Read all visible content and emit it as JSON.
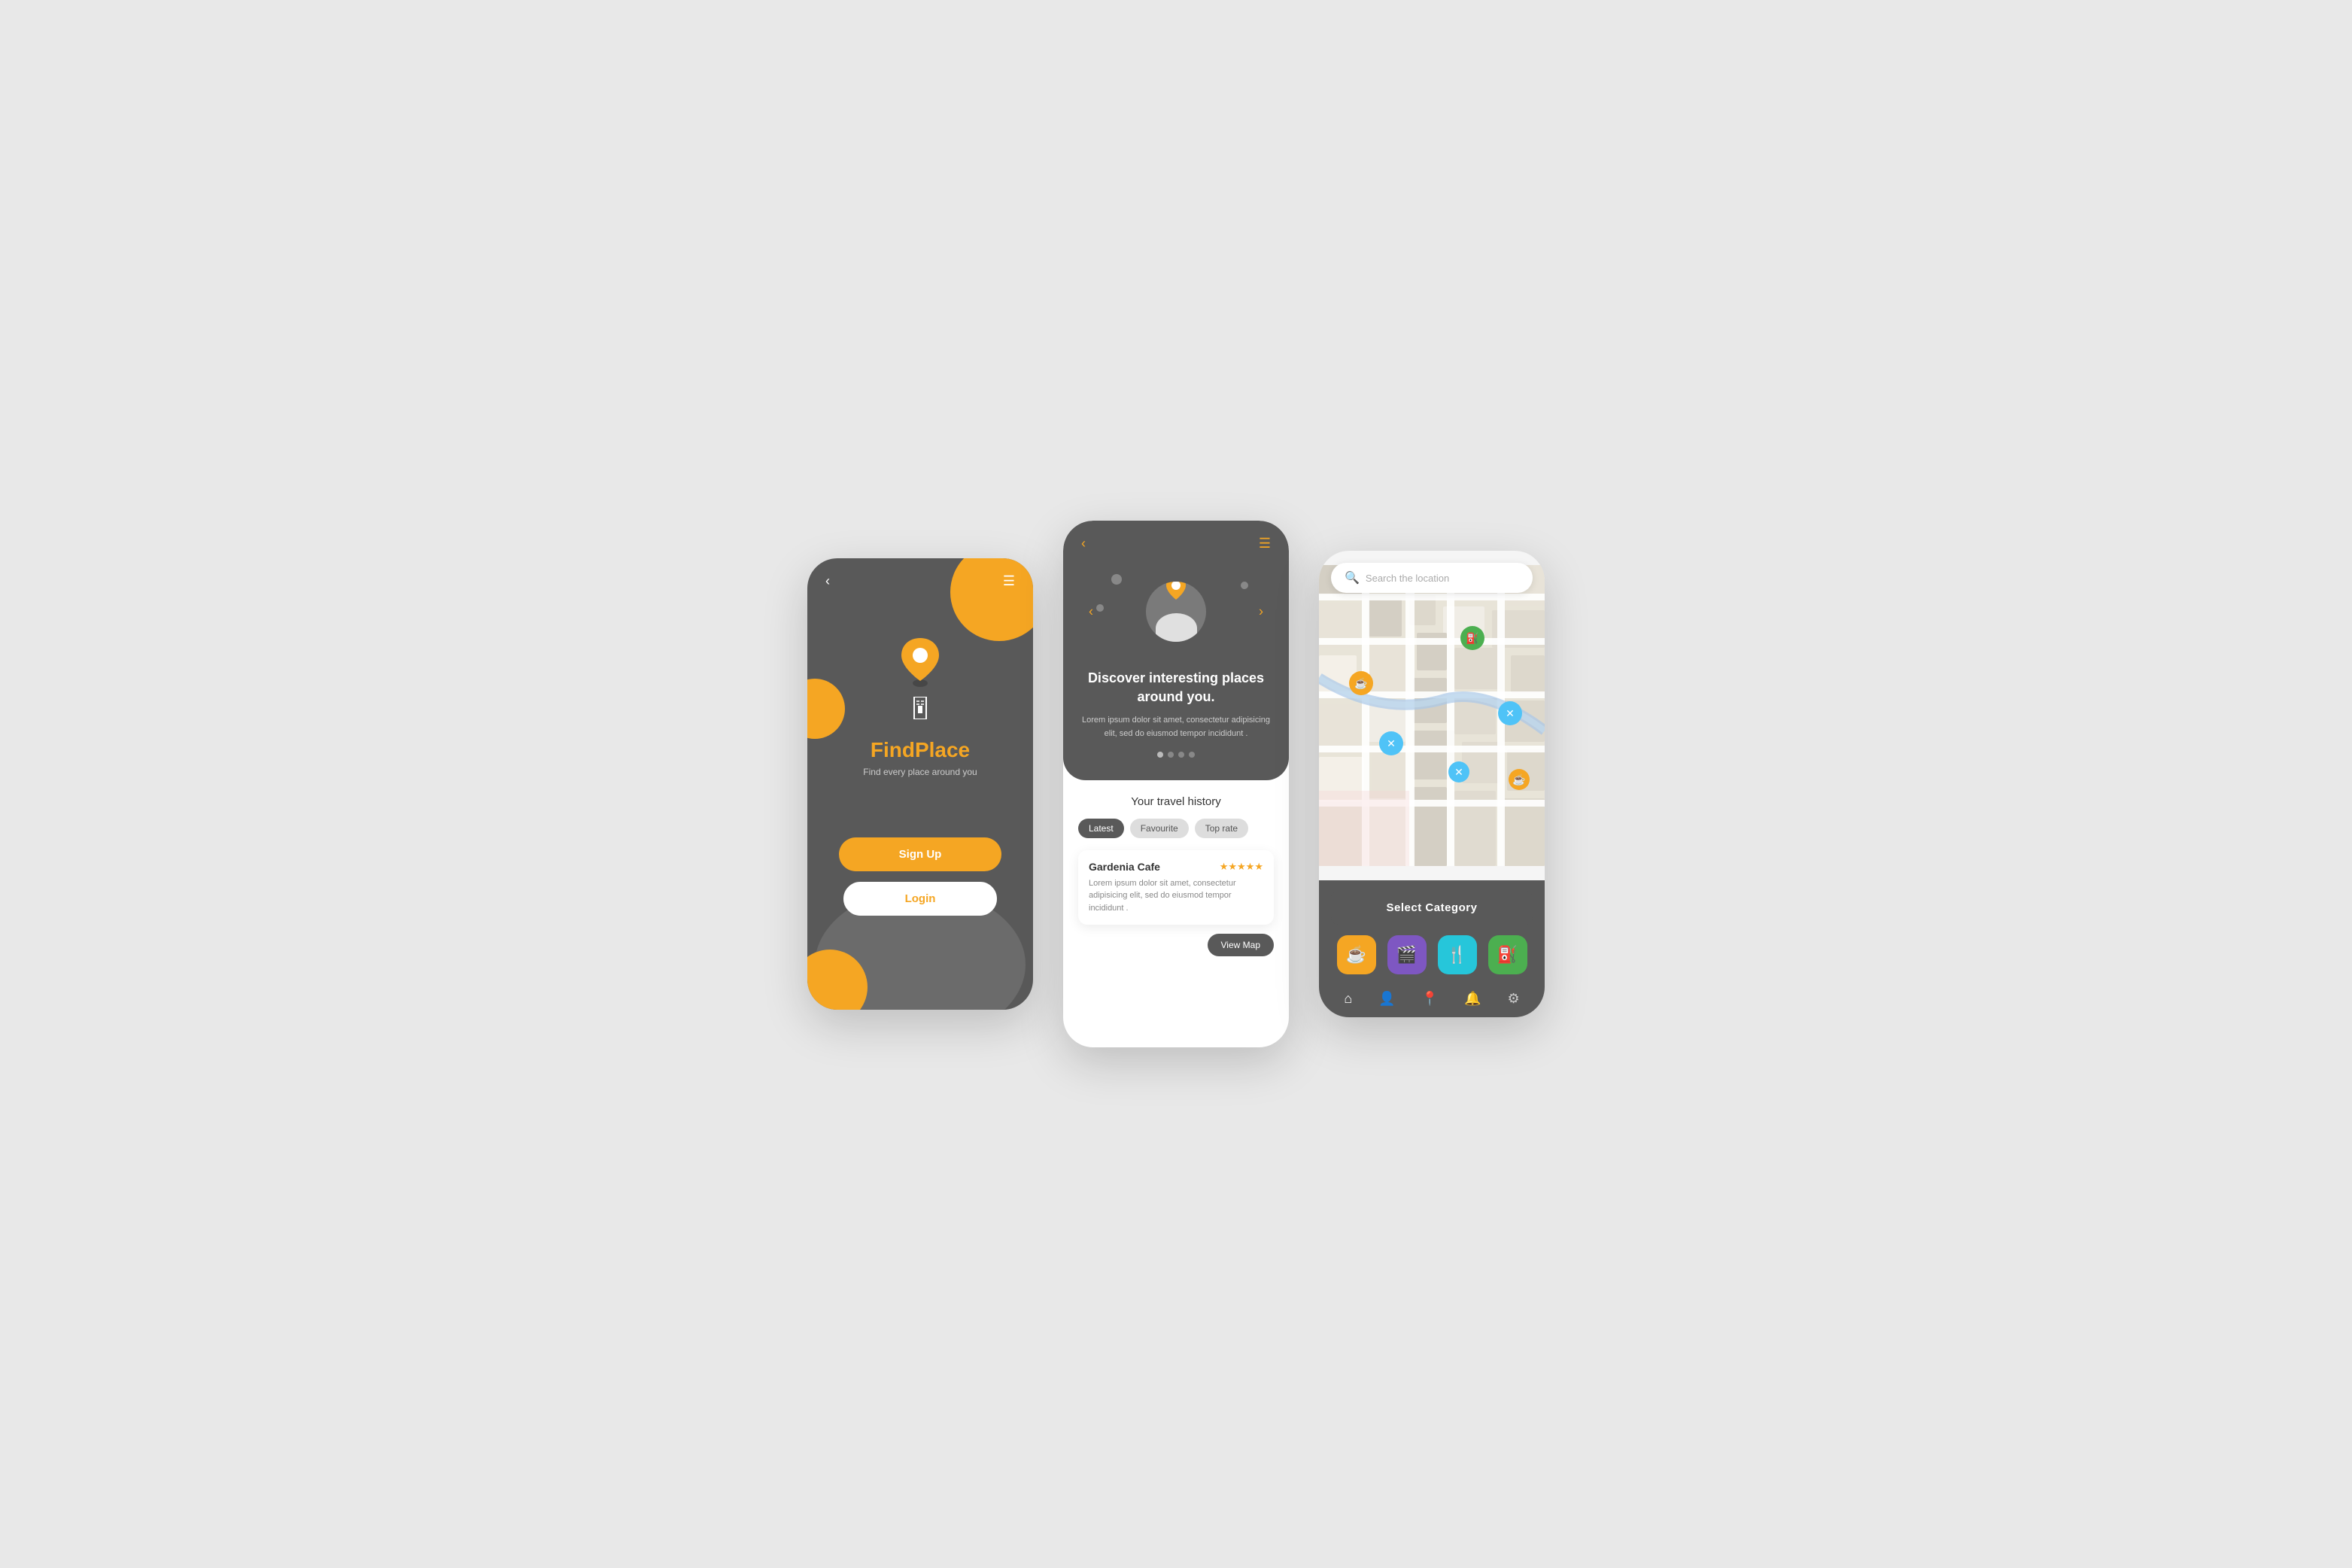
{
  "screen1": {
    "back_label": "‹",
    "menu_label": "☰",
    "app_name_regular": "Find",
    "app_name_bold": "Place",
    "subtitle": "Find every place around you",
    "signup_label": "Sign Up",
    "login_label": "Login"
  },
  "screen2": {
    "back_label": "‹",
    "menu_label": "☰",
    "discover_title": "Discover interesting places around you.",
    "discover_desc": "Lorem ipsum dolor sit amet, consectetur adipisicing elit, sed do eiusmod tempor incididunt .",
    "travel_history_label": "Your travel history",
    "tabs": [
      {
        "label": "Latest",
        "active": true
      },
      {
        "label": "Favourite",
        "active": false
      },
      {
        "label": "Top rate",
        "active": false
      }
    ],
    "place_name": "Gardenia Cafe",
    "stars": "★★★★★",
    "place_desc": "Lorem ipsum dolor sit amet, consectetur adipisicing elit, sed do eiusmod tempor incididunt .",
    "view_map_label": "View Map"
  },
  "screen3": {
    "search_placeholder": "Search the location",
    "select_category_label": "Select Category",
    "categories": [
      {
        "icon": "☕",
        "color": "cat-orange",
        "name": "cafe"
      },
      {
        "icon": "🎬",
        "color": "cat-purple",
        "name": "cinema"
      },
      {
        "icon": "🍴",
        "color": "cat-blue",
        "name": "restaurant"
      },
      {
        "icon": "⛽",
        "color": "cat-green",
        "name": "gas-station"
      }
    ],
    "nav_items": [
      {
        "icon": "⌂",
        "name": "home",
        "active": true
      },
      {
        "icon": "👤",
        "name": "profile"
      },
      {
        "icon": "📍",
        "name": "location"
      },
      {
        "icon": "🔔",
        "name": "notifications"
      },
      {
        "icon": "⚙",
        "name": "settings"
      }
    ]
  }
}
